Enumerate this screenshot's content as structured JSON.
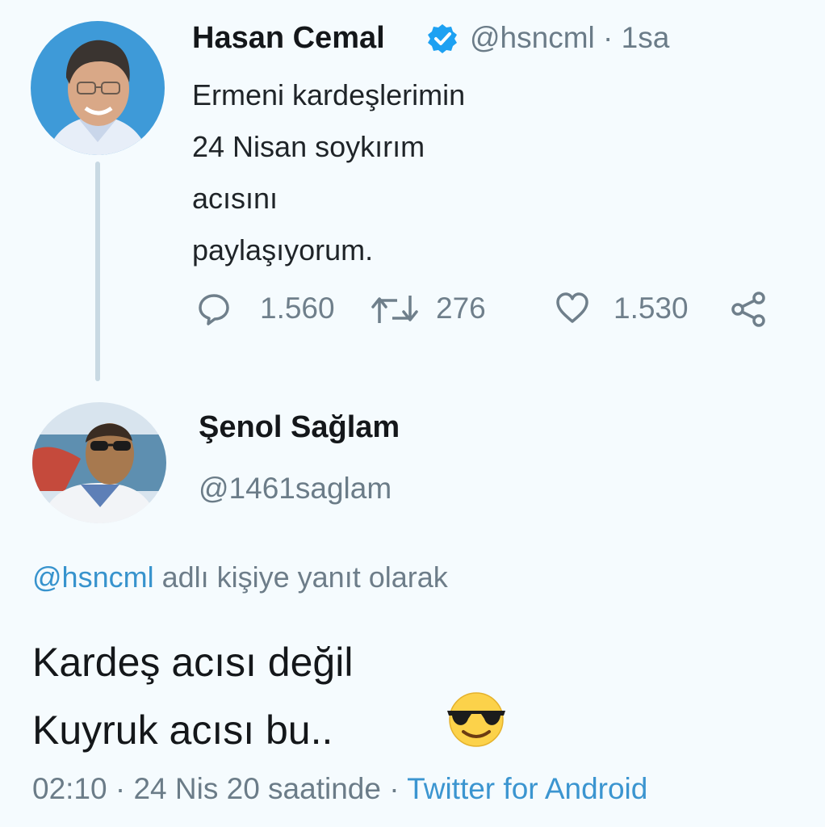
{
  "tweet1": {
    "display_name": "Hasan Cemal",
    "handle_time": "@hsncml · 1sa",
    "text_lines": [
      "Ermeni kardeşlerimin",
      "24 Nisan soykırım",
      "acısını",
      "paylaşıyorum."
    ],
    "reply_count": "1.560",
    "retweet_count": "276",
    "like_count": "1.530",
    "verified": true
  },
  "tweet2": {
    "display_name": "Şenol Sağlam",
    "handle": "@1461saglam",
    "reply_to_mention": "@hsncml",
    "reply_to_suffix": " adlı kişiye yanıt olarak",
    "text_lines": [
      "Kardeş acısı değil",
      "Kuyruk acısı bu.."
    ],
    "emoji": "smiling-face-with-sunglasses",
    "timestamp": "02:10 · 24 Nis 20 saatinde · ",
    "source": "Twitter for Android"
  },
  "colors": {
    "background": "#f5fbfe",
    "verified_badge": "#1da1f2",
    "link": "#3793cd",
    "muted": "#6b7c88"
  }
}
